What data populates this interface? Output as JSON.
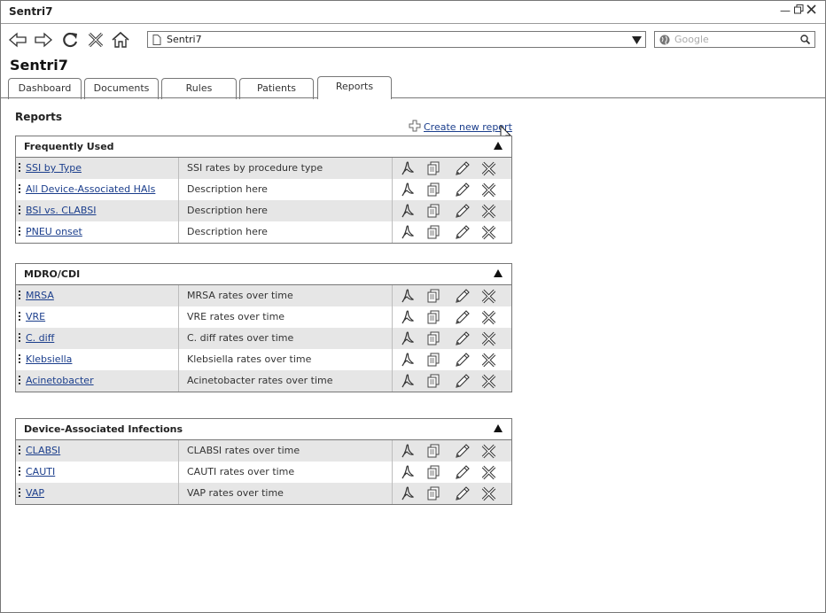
{
  "window": {
    "title": "Sentri7"
  },
  "navbar": {
    "url": "Sentri7",
    "search_placeholder": "Google"
  },
  "page": {
    "title": "Sentri7"
  },
  "tabs": [
    {
      "label": "Dashboard"
    },
    {
      "label": "Documents"
    },
    {
      "label": "Rules"
    },
    {
      "label": "Patients"
    },
    {
      "label": "Reports"
    }
  ],
  "reports": {
    "heading": "Reports",
    "create_label": "Create new report",
    "groups": [
      {
        "title": "Frequently Used",
        "rows": [
          {
            "name": "SSI by Type",
            "desc": "SSI rates by procedure  type"
          },
          {
            "name": "All Device-Associated HAIs",
            "desc": "Description here"
          },
          {
            "name": "BSI vs. CLABSI",
            "desc": "Description here"
          },
          {
            "name": "PNEU onset",
            "desc": "Description here"
          }
        ]
      },
      {
        "title": "MDRO/CDI",
        "rows": [
          {
            "name": "MRSA",
            "desc": "MRSA rates over time"
          },
          {
            "name": "VRE",
            "desc": "VRE rates over time"
          },
          {
            "name": "C. diff",
            "desc": "C. diff rates over  time"
          },
          {
            "name": "Klebsiella",
            "desc": "Klebsiella rates over time"
          },
          {
            "name": "Acinetobacter",
            "desc": "Acinetobacter rates over  time"
          }
        ]
      },
      {
        "title": "Device-Associated Infections",
        "rows": [
          {
            "name": "CLABSI",
            "desc": "CLABSI rates over time"
          },
          {
            "name": "CAUTI",
            "desc": "CAUTI rates over time"
          },
          {
            "name": "VAP",
            "desc": "VAP rates over time"
          }
        ]
      }
    ]
  },
  "icons": {
    "back": "back-arrow-icon",
    "forward": "forward-arrow-icon",
    "reload": "reload-icon",
    "stop": "stop-icon",
    "home": "home-icon",
    "pdf": "pdf-icon",
    "copy": "copy-icon",
    "edit": "pencil-icon",
    "delete": "delete-icon",
    "collapse": "collapse-triangle-icon"
  },
  "colors": {
    "link": "#1b3e8c",
    "shaded_row": "#e6e6e6",
    "border": "#777777"
  }
}
